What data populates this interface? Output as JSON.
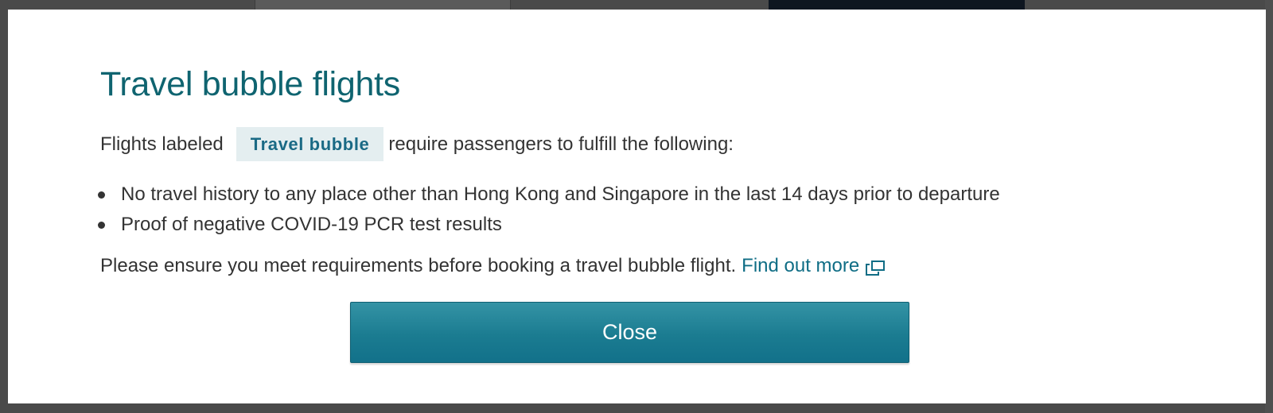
{
  "modal": {
    "title": "Travel bubble flights",
    "intro_before": "Flights labeled",
    "tag_label": "Travel bubble",
    "intro_after": "require passengers to fulfill the following:",
    "requirements": [
      "No travel history to any place other than Hong Kong and Singapore in the last 14 days prior to departure",
      "Proof of negative COVID-19 PCR test results"
    ],
    "notice_text": "Please ensure you meet requirements before booking a travel bubble flight.",
    "find_more_label": "Find out more",
    "find_more_icon": "external-link-icon",
    "close_label": "Close"
  },
  "colors": {
    "title": "#0f6470",
    "link": "#0f6d85",
    "tag_background": "#e4eef0",
    "tag_text": "#1a6a85",
    "button": "#1b7c91",
    "backdrop": "#4a4a4a"
  }
}
